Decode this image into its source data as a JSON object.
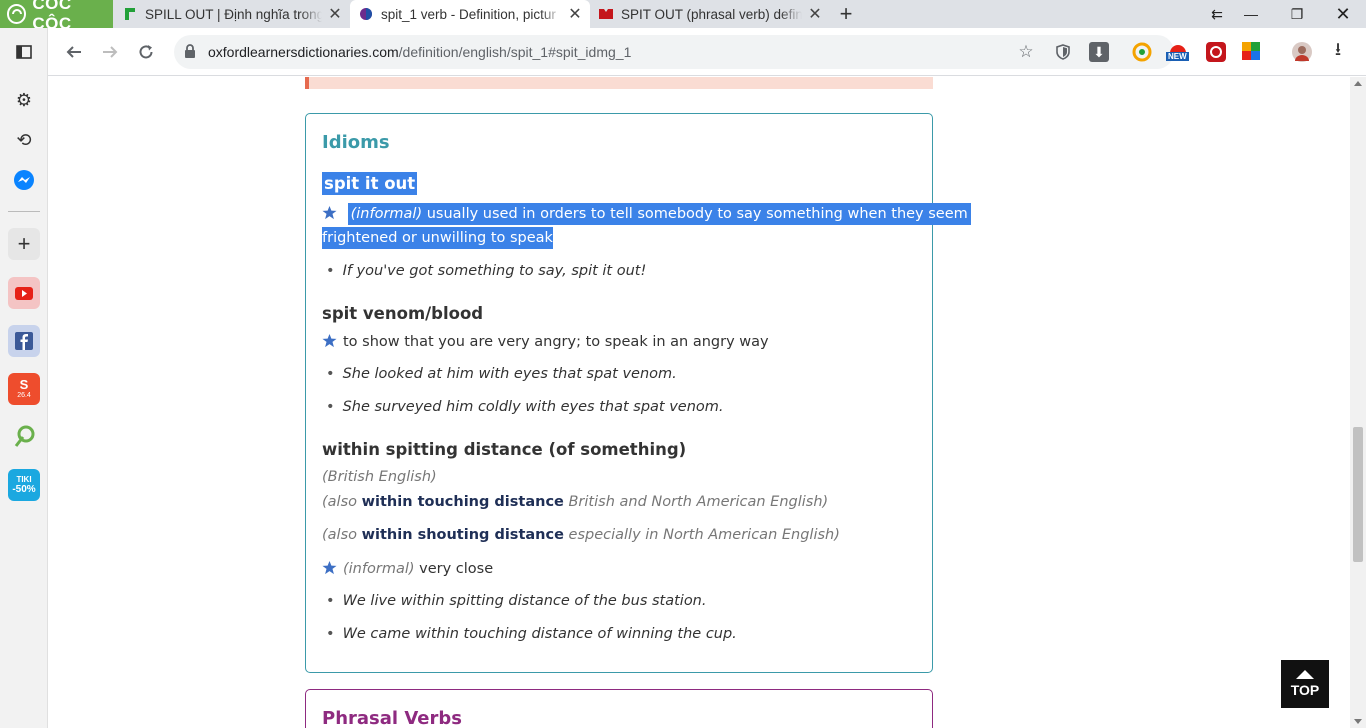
{
  "browser": {
    "logo_text": "CÔC CÔC",
    "tabs": [
      {
        "title": "SPILL OUT | Định nghĩa trong",
        "active": false,
        "favicon_color": "#21a038"
      },
      {
        "title": "spit_1 verb - Definition, pictur",
        "active": true,
        "favicon_color": "#6b2b8c"
      },
      {
        "title": "SPIT OUT (phrasal verb) defin",
        "active": false,
        "favicon_color": "#c4161c"
      }
    ],
    "url_host": "oxfordlearnersdictionaries.com",
    "url_path": "/definition/english/spit_1#spit_idmg_1",
    "ext_new_badge": "NEW"
  },
  "sidebar": {
    "shopee_badge": "26.4",
    "tiki_line1": "TIKI",
    "tiki_line2": "-50%"
  },
  "page": {
    "idioms_title": "Idioms",
    "idioms": [
      {
        "phrase": "spit it out",
        "label": "(informal)",
        "definition_line1": "usually used in orders to tell somebody to say something when they seem",
        "definition_line2": "frightened or unwilling to speak",
        "examples": [
          "If you've got something to say, spit it out!"
        ]
      },
      {
        "phrase": "spit venom/blood",
        "definition": "to show that you are very angry; to speak in an angry way",
        "examples": [
          "She looked at him with eyes that spat venom.",
          "She surveyed him coldly with eyes that spat venom."
        ]
      },
      {
        "phrase": "within spitting distance (of something)",
        "region": "(British English)",
        "variant1_open": "(also",
        "variant1_phrase": "within touching distance",
        "variant1_region": "British and North American English)",
        "variant2_open": "(also",
        "variant2_phrase": "within shouting distance",
        "variant2_region": "especially in North American English)",
        "label": "(informal)",
        "definition": "very close",
        "examples": [
          "We live within spitting distance of the bus station.",
          "We came within touching distance of winning the cup."
        ]
      }
    ],
    "phrasal_title": "Phrasal Verbs",
    "top_label": "TOP"
  },
  "colors": {
    "accent_teal": "#3b9aa9",
    "phrasal_purple": "#8e2a80",
    "selection_blue": "#3b82e8",
    "star_blue": "#3d6fc4"
  }
}
